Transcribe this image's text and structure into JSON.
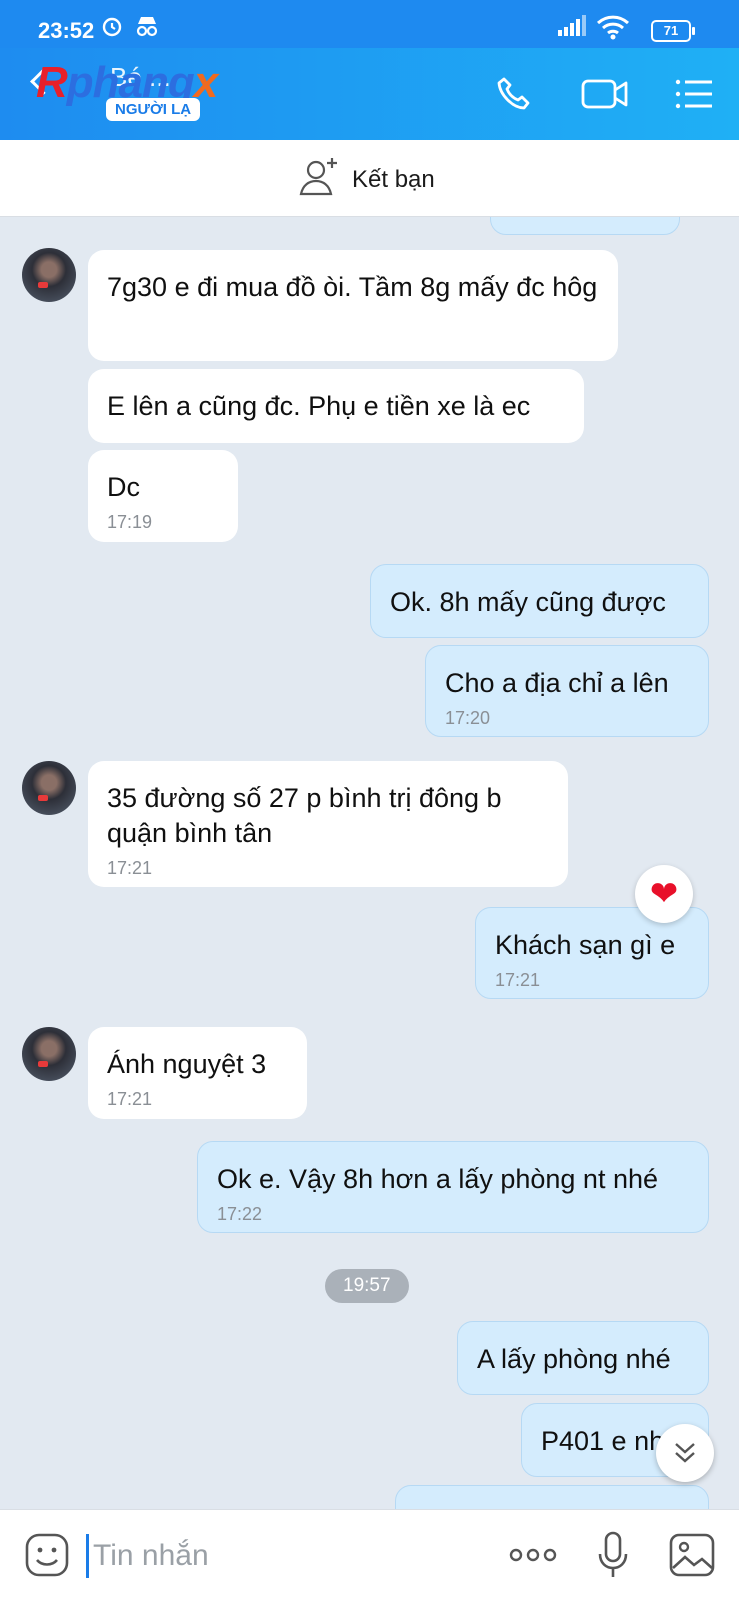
{
  "status_bar": {
    "time": "23:52",
    "battery": "71"
  },
  "header": {
    "contact_name": "Bé ...",
    "stranger_badge": "NGƯỜI LẠ",
    "watermark": "Rphangx"
  },
  "add_friend": {
    "label": "Kết bạn"
  },
  "messages": [
    {
      "dir": "in",
      "text": "7g30 e đi mua đồ òi. Tầm 8g mấy đc hôg",
      "time": ""
    },
    {
      "dir": "in",
      "text": "E lên a cũng đc. Phụ e tiền xe là ec",
      "time": ""
    },
    {
      "dir": "in",
      "text": "Dc",
      "time": "17:19"
    },
    {
      "dir": "out",
      "text": "Ok. 8h mấy cũng được",
      "time": ""
    },
    {
      "dir": "out",
      "text": "Cho a địa chỉ a lên",
      "time": "17:20"
    },
    {
      "dir": "in",
      "text": "35 đường số 27 p bình trị đông b quận bình tân",
      "time": "17:21"
    },
    {
      "dir": "out",
      "text": "Khách sạn gì e",
      "time": "17:21",
      "reaction": "heart"
    },
    {
      "dir": "in",
      "text": "Ánh nguyệt 3",
      "time": "17:21"
    },
    {
      "dir": "out",
      "text": "Ok e. Vậy 8h hơn a lấy phòng nt nhé",
      "time": "17:22"
    },
    {
      "dir": "out",
      "text": "A lấy phòng nhé",
      "time": ""
    },
    {
      "dir": "out",
      "text": "P401 e nhé",
      "time": ""
    }
  ],
  "date_separator": "19:57",
  "input": {
    "placeholder": "Tin nhắn"
  },
  "icons": {
    "status": [
      "alarm-icon",
      "incognito-icon",
      "signal-icon",
      "wifi-icon",
      "battery-icon"
    ],
    "header": [
      "back-icon",
      "phone-icon",
      "video-call-icon",
      "menu-icon"
    ],
    "input": [
      "sticker-icon",
      "more-icon",
      "microphone-icon",
      "image-icon"
    ]
  },
  "colors": {
    "header": "#1e8af0",
    "outgoing_bubble": "#d4ecfd",
    "incoming_bubble": "#ffffff",
    "chat_bg": "#e2e9f1",
    "accent": "#1a7ce8"
  }
}
